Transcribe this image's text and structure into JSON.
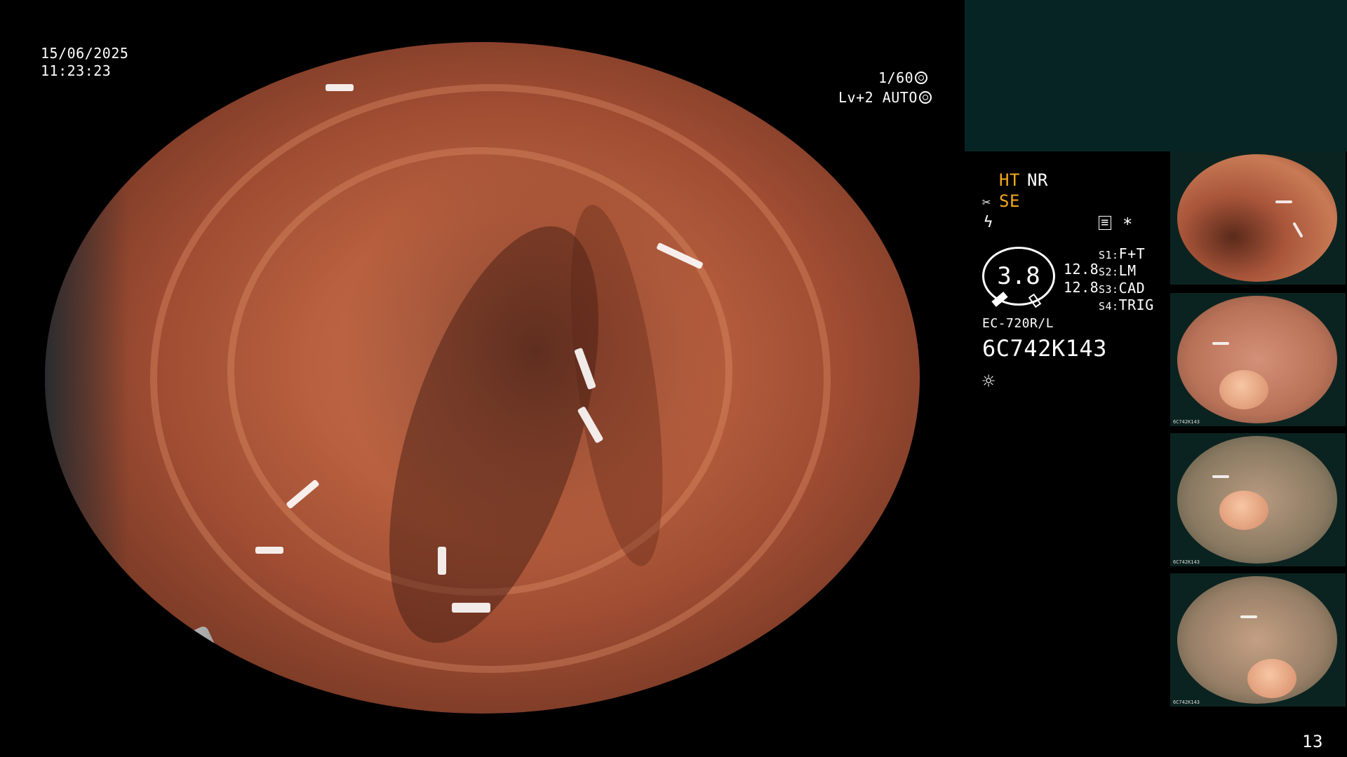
{
  "datetime": {
    "date": "15/06/2025",
    "time": "11:23:23"
  },
  "exposure": {
    "shutter": "1/60",
    "level": "Lv+2",
    "mode": "AUTO"
  },
  "settings": {
    "ht": "HT",
    "nr": "NR",
    "se": "SE",
    "star": "*",
    "gauge_value": "3.8",
    "ratio_top": "12.8",
    "ratio_bottom": "12.8"
  },
  "switches": [
    {
      "key": "S1:",
      "value": "F+T"
    },
    {
      "key": "S2:",
      "value": "LM"
    },
    {
      "key": "S3:",
      "value": "CAD"
    },
    {
      "key": "S4:",
      "value": "TRIG"
    }
  ],
  "scope": {
    "model": "EC-720R/L",
    "serial": "6C742K143"
  },
  "frame_count": "13",
  "thumb_caption": "6C742K143",
  "icons": [
    "shutter-icon",
    "auto-iris-icon",
    "scissors-icon",
    "lightning-icon",
    "memo-icon",
    "gauge-icon",
    "light-source-icon"
  ]
}
